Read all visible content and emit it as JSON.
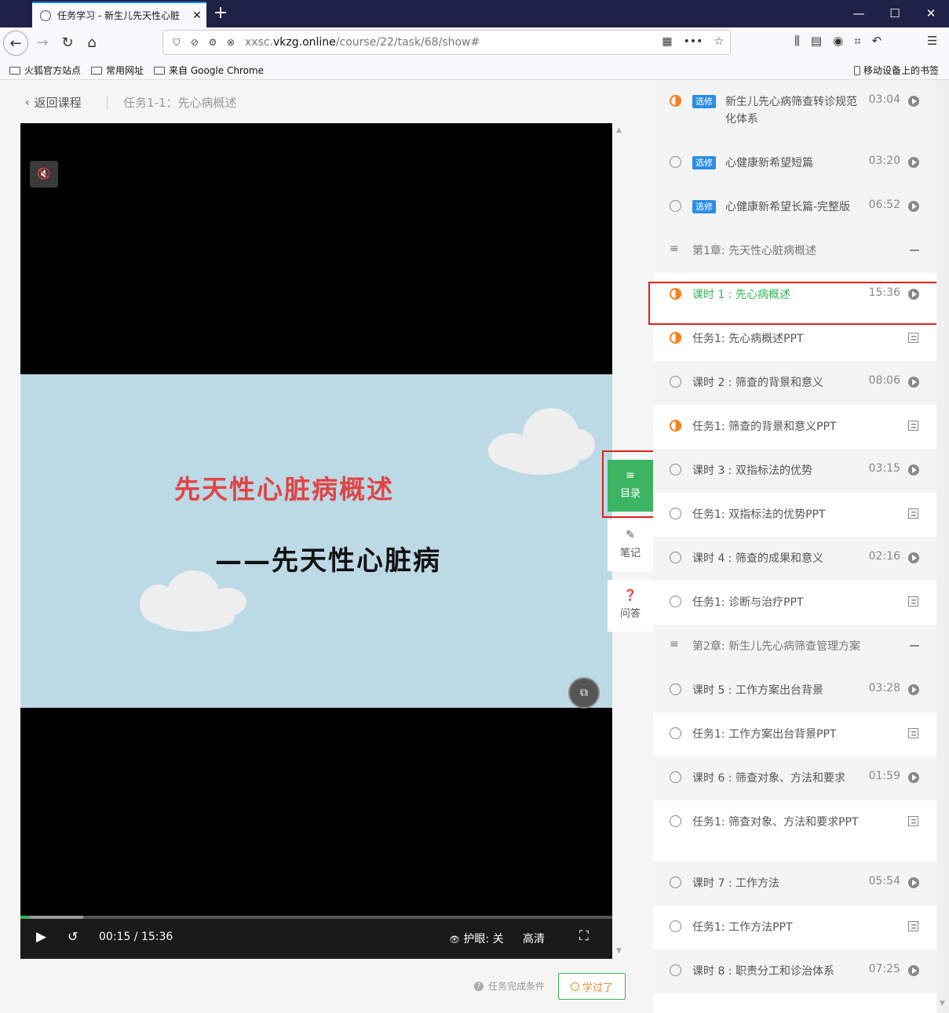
{
  "browser": {
    "tab_title": "任务学习 - 新生儿先天性心脏",
    "url_muted": "xxsc.",
    "url_domain": "vkzg.online",
    "url_path": "/course/22/task/68/show#",
    "bookmarks": [
      "火狐官方站点",
      "常用网址",
      "来自 Google Chrome"
    ],
    "mobile_bookmarks": "移动设备上的书签"
  },
  "header": {
    "back_label": "返回课程",
    "task_title": "任务1-1：先心病概述"
  },
  "slide": {
    "title": "先天性心脏病概述",
    "subtitle": "——先天性心脏病"
  },
  "player": {
    "time": "00:15 / 15:36",
    "progress_percent": 1.6,
    "eye_care": "护眼: 关",
    "quality": "高清"
  },
  "side_tabs": {
    "catalog": "目录",
    "notes": "笔记",
    "qa": "问答"
  },
  "footer": {
    "completion_condition": "任务完成条件",
    "learned_button": "学过了"
  },
  "catalog": [
    {
      "kind": "item",
      "status": "half",
      "tag": "选修",
      "name": "新生儿先心病筛查转诊规范化体系",
      "duration": "03:04",
      "action": "play"
    },
    {
      "kind": "item",
      "status": "empty",
      "tag": "选修",
      "name": "心健康新希望短篇",
      "duration": "03:20",
      "action": "play"
    },
    {
      "kind": "item",
      "status": "empty",
      "tag": "选修",
      "name": "心健康新希望长篇-完整版",
      "duration": "06:52",
      "action": "play"
    },
    {
      "kind": "chapter",
      "name": "第1章: 先天性心脏病概述"
    },
    {
      "kind": "item",
      "status": "half",
      "name": "课时 1 : 先心病概述",
      "duration": "15:36",
      "action": "play",
      "current": true
    },
    {
      "kind": "item",
      "status": "half",
      "name": "任务1:   先心病概述PPT",
      "duration": "",
      "action": "doc"
    },
    {
      "kind": "item",
      "status": "empty",
      "name": "课时 2 : 筛查的背景和意义",
      "duration": "08:06",
      "action": "play"
    },
    {
      "kind": "item",
      "status": "half",
      "name": "任务1:   筛查的背景和意义PPT",
      "duration": "",
      "action": "doc"
    },
    {
      "kind": "item",
      "status": "empty",
      "name": "课时 3 : 双指标法的优势",
      "duration": "03:15",
      "action": "play"
    },
    {
      "kind": "item",
      "status": "empty",
      "name": "任务1:   双指标法的优势PPT",
      "duration": "",
      "action": "doc"
    },
    {
      "kind": "item",
      "status": "empty",
      "name": "课时 4 : 筛查的成果和意义",
      "duration": "02:16",
      "action": "play"
    },
    {
      "kind": "item",
      "status": "empty",
      "name": "任务1:   诊断与治疗PPT",
      "duration": "",
      "action": "doc"
    },
    {
      "kind": "chapter",
      "name": "第2章: 新生儿先心病筛查管理方案"
    },
    {
      "kind": "item",
      "status": "empty",
      "name": "课时 5 : 工作方案出台背景",
      "duration": "03:28",
      "action": "play"
    },
    {
      "kind": "item",
      "status": "empty",
      "name": "任务1:   工作方案出台背景PPT",
      "duration": "",
      "action": "doc"
    },
    {
      "kind": "item",
      "status": "empty",
      "name": "课时 6 : 筛查对象、方法和要求",
      "duration": "01:59",
      "action": "play"
    },
    {
      "kind": "item",
      "status": "empty",
      "name": "任务1:   筛查对象、方法和要求PPT",
      "duration": "",
      "action": "doc"
    },
    {
      "kind": "item",
      "status": "empty",
      "name": "课时 7 : 工作方法",
      "duration": "05:54",
      "action": "play"
    },
    {
      "kind": "item",
      "status": "empty",
      "name": "任务1:   工作方法PPT",
      "duration": "",
      "action": "doc"
    },
    {
      "kind": "item",
      "status": "empty",
      "name": "课时 8 : 职责分工和诊治体系",
      "duration": "07:25",
      "action": "play"
    }
  ]
}
